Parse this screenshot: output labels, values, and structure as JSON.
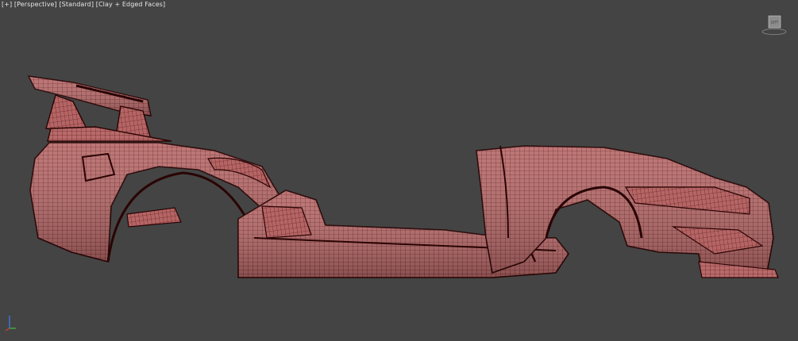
{
  "viewport": {
    "menu_plus": "[+]",
    "menu_view": "[Perspective]",
    "menu_shading": "[Standard]",
    "menu_style": "[Clay + Edged Faces]"
  },
  "viewcube": {
    "face_label": "LEFT",
    "icon": "viewcube-icon"
  },
  "colors": {
    "background": "#444444",
    "mesh_fill": "#b86a6a",
    "mesh_wire": "#4a0c0c",
    "outline": "#2a0404"
  }
}
